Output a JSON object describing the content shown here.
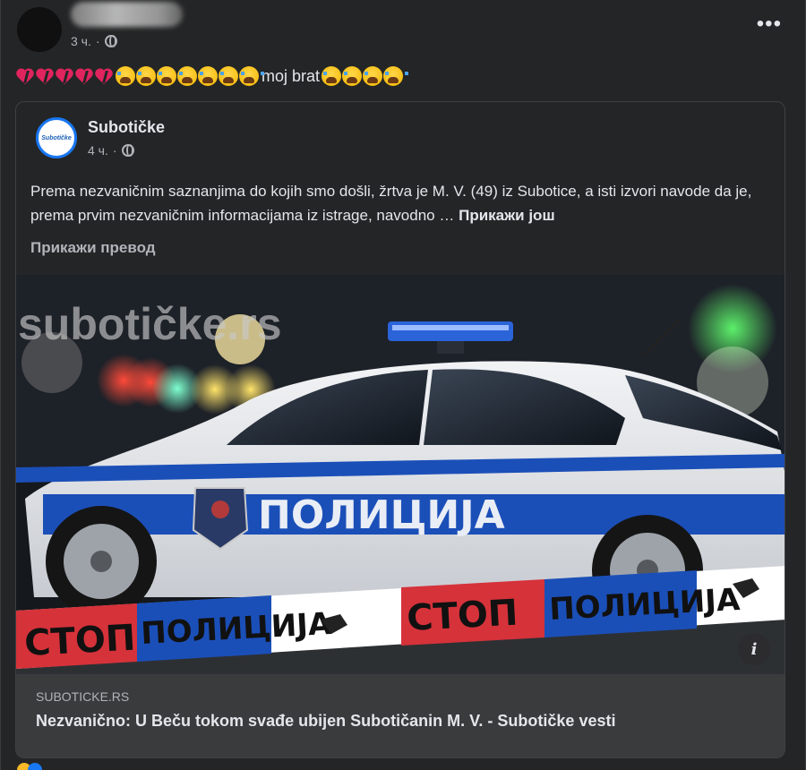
{
  "post": {
    "time": "3 ч.",
    "separator": "·",
    "text": "moj brat",
    "more_label": "•••"
  },
  "shared": {
    "page_name": "Subotičke",
    "logo_text": "Subotičke",
    "time": "4 ч.",
    "separator": "·",
    "body": "Prema nezvaničnim saznanjima do kojih smo došli, žrtva je M. V. (49) iz Subotice, a isti izvori navode da je, prema prvim nezvaničnim informacijama iz istrage, navodno …",
    "see_more": "Прикажи још",
    "translate": "Прикажи превод"
  },
  "image": {
    "watermark": "subotičke.rs",
    "car_text": "ПОЛИЦИЈА",
    "tape_stop": "СТОП",
    "tape_police": "ПОЛИЦИЈА",
    "info_label": "i"
  },
  "link": {
    "domain": "SUBOTICKE.RS",
    "title": "Nezvanično: U Beču tokom svađe ubijen Subotičanin M. V. - Subotičke vesti"
  },
  "colors": {
    "background": "#242526",
    "text": "#e4e6eb",
    "secondary": "#b0b3b8",
    "link_bg": "#3a3b3c",
    "police_blue": "#1b4fb8",
    "tape_red": "#d6323a"
  }
}
